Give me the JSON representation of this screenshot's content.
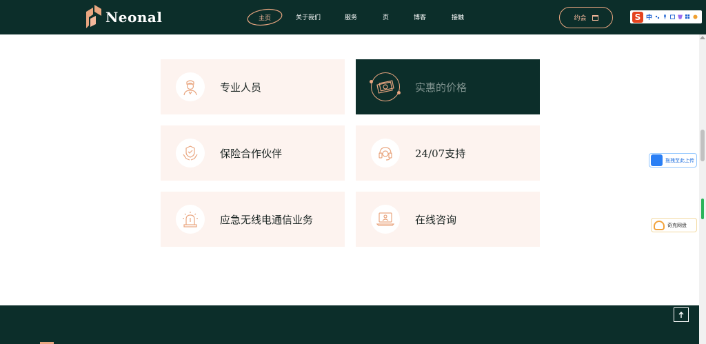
{
  "header": {
    "brand": "Neonal",
    "nav": [
      {
        "label": "主页",
        "active": true
      },
      {
        "label": "关于我们"
      },
      {
        "label": "服务"
      },
      {
        "label": "页"
      },
      {
        "label": "博客"
      },
      {
        "label": "接触"
      }
    ],
    "appointment_label": "约会",
    "ime": {
      "lang": "中"
    }
  },
  "features": [
    {
      "title": "专业人员",
      "icon": "nurse-icon",
      "active": false
    },
    {
      "title": "实惠的价格",
      "icon": "money-icon",
      "active": true
    },
    {
      "title": "保险合作伙伴",
      "icon": "shield-hands-icon",
      "active": false
    },
    {
      "title": "24/07支持",
      "icon": "headset-icon",
      "active": false
    },
    {
      "title": "应急无线电通信业务",
      "icon": "siren-icon",
      "active": false
    },
    {
      "title": "在线咨询",
      "icon": "laptop-consult-icon",
      "active": false
    }
  ],
  "side_widgets": {
    "upload_label": "拖拽至此上传",
    "cloud_label": "奇克网盘"
  },
  "footer": {
    "to_top_icon": "arrow-up-icon"
  },
  "colors": {
    "primary": "#0c2e2a",
    "accent": "#e9a680",
    "card_bg": "#fdf3ef"
  }
}
